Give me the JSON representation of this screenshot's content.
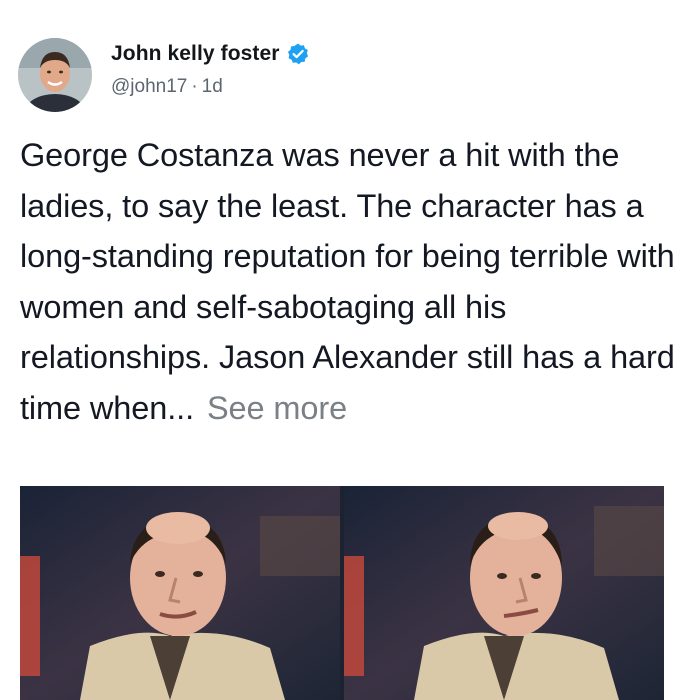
{
  "tweet": {
    "author": {
      "display_name": "John kelly foster",
      "handle": "@john17",
      "verified_icon": "verified-badge-icon",
      "avatar_icon": "avatar-photo"
    },
    "separator": "·",
    "time_ago": "1d",
    "body_text": "George Costanza was never a hit with the ladies, to say the least. The character has a long-standing reputation for being terrible with women and self-sabotaging all his relationships. Jason Alexander still has a hard time when...",
    "see_more_label": "See more",
    "media": {
      "images": [
        {
          "name": "interview-still-left"
        },
        {
          "name": "interview-still-right"
        }
      ]
    }
  },
  "colors": {
    "verified_blue": "#1da1f2",
    "secondary_text": "#5b6670",
    "see_more": "#7a8086",
    "body_text": "#141823"
  }
}
